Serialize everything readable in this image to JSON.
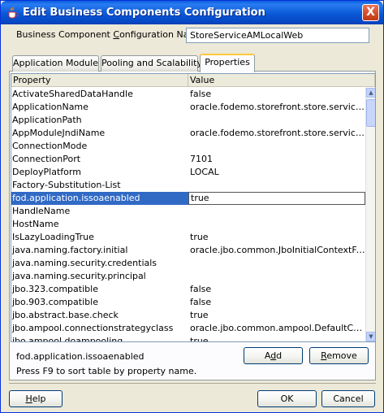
{
  "window": {
    "title": "Edit Business Components Configuration",
    "close_glyph": "X"
  },
  "config_name": {
    "label": "Business Component Configuration Name:",
    "value": "StoreServiceAMLocalWeb"
  },
  "tabs": [
    {
      "label": "Application Module",
      "active": false
    },
    {
      "label": "Pooling and Scalability",
      "active": false
    },
    {
      "label": "Properties",
      "active": true
    }
  ],
  "table": {
    "columns": [
      "Property",
      "Value"
    ],
    "rows": [
      {
        "property": "ActivateSharedDataHandle",
        "value": "false"
      },
      {
        "property": "ApplicationName",
        "value": "oracle.fodemo.storefront.store.service.S..."
      },
      {
        "property": "ApplicationPath",
        "value": ""
      },
      {
        "property": "AppModuleJndiName",
        "value": "oracle.fodemo.storefront.store.service.S..."
      },
      {
        "property": "ConnectionMode",
        "value": ""
      },
      {
        "property": "ConnectionPort",
        "value": "7101"
      },
      {
        "property": "DeployPlatform",
        "value": "LOCAL"
      },
      {
        "property": "Factory-Substitution-List",
        "value": ""
      },
      {
        "property": "fod.application.issoaenabled",
        "value": "true"
      },
      {
        "property": "HandleName",
        "value": ""
      },
      {
        "property": "HostName",
        "value": ""
      },
      {
        "property": "IsLazyLoadingTrue",
        "value": "true"
      },
      {
        "property": "java.naming.factory.initial",
        "value": "oracle.jbo.common.JboInitialContextFactory"
      },
      {
        "property": "java.naming.security.credentials",
        "value": ""
      },
      {
        "property": "java.naming.security.principal",
        "value": ""
      },
      {
        "property": "jbo.323.compatible",
        "value": "false"
      },
      {
        "property": "jbo.903.compatible",
        "value": "false"
      },
      {
        "property": "jbo.abstract.base.check",
        "value": "true"
      },
      {
        "property": "jbo.ampool.connectionstrategyclass",
        "value": "oracle.jbo.common.ampool.DefaultConne..."
      },
      {
        "property": "jbo.ampool.doampooling",
        "value": "true"
      }
    ],
    "selected_index": 8
  },
  "description": "fod.application.issoaenabled",
  "hint": "Press F9 to sort table by property name.",
  "buttons": {
    "add": "Add",
    "remove": "Remove",
    "help": "Help",
    "ok": "OK",
    "cancel": "Cancel"
  },
  "colors": {
    "selection": "#316ac5",
    "titlebar": "#0a58d6"
  },
  "icons": {
    "title_icon": "java-cup-icon",
    "scroll_up": "arrow-up-icon",
    "scroll_down": "arrow-down-icon"
  }
}
